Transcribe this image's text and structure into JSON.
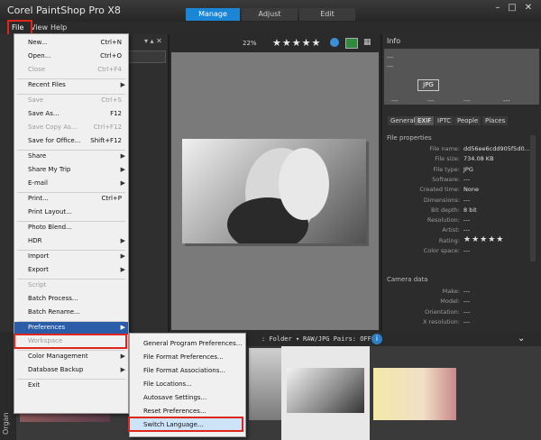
{
  "app": {
    "title": "Corel PaintShop Pro X8",
    "tabs": [
      "Manage",
      "Adjust",
      "Edit"
    ],
    "window_buttons": [
      "–",
      "□",
      "✕"
    ]
  },
  "menubar": [
    "File",
    "View",
    "Help"
  ],
  "toolbar": {
    "zoom": "22%",
    "rating_stars": "★★★★★"
  },
  "file_menu": {
    "items": [
      {
        "label": "New...",
        "shortcut": "Ctrl+N",
        "disabled": false
      },
      {
        "label": "Open...",
        "shortcut": "Ctrl+O",
        "disabled": false
      },
      {
        "label": "Close",
        "shortcut": "Ctrl+F4",
        "disabled": true
      },
      {
        "label": "Recent Files",
        "shortcut": "",
        "disabled": false,
        "submenu": true
      },
      {
        "label": "Save",
        "shortcut": "Ctrl+S",
        "disabled": true
      },
      {
        "label": "Save As...",
        "shortcut": "F12",
        "disabled": false
      },
      {
        "label": "Save Copy As...",
        "shortcut": "Ctrl+F12",
        "disabled": true
      },
      {
        "label": "Save for Office...",
        "shortcut": "Shift+F12",
        "disabled": false
      },
      {
        "label": "Share",
        "shortcut": "",
        "disabled": false,
        "submenu": true
      },
      {
        "label": "Share My Trip",
        "shortcut": "",
        "disabled": false,
        "submenu": true
      },
      {
        "label": "E-mail",
        "shortcut": "",
        "disabled": false,
        "submenu": true
      },
      {
        "label": "Print...",
        "shortcut": "Ctrl+P",
        "disabled": false
      },
      {
        "label": "Print Layout...",
        "shortcut": "",
        "disabled": false
      },
      {
        "label": "Photo Blend...",
        "shortcut": "",
        "disabled": false
      },
      {
        "label": "HDR",
        "shortcut": "",
        "disabled": false,
        "submenu": true
      },
      {
        "label": "Import",
        "shortcut": "",
        "disabled": false,
        "submenu": true
      },
      {
        "label": "Export",
        "shortcut": "",
        "disabled": false,
        "submenu": true
      },
      {
        "label": "Script",
        "shortcut": "",
        "disabled": true
      },
      {
        "label": "Batch Process...",
        "shortcut": "",
        "disabled": false
      },
      {
        "label": "Batch Rename...",
        "shortcut": "",
        "disabled": false
      },
      {
        "label": "Preferences",
        "shortcut": "",
        "disabled": false,
        "submenu": true
      },
      {
        "label": "Workspace",
        "shortcut": "",
        "disabled": true
      },
      {
        "label": "Color Management",
        "shortcut": "",
        "disabled": false,
        "submenu": true
      },
      {
        "label": "Database Backup",
        "shortcut": "",
        "disabled": false,
        "submenu": true
      },
      {
        "label": "Exit",
        "shortcut": "",
        "disabled": false
      }
    ]
  },
  "preferences_submenu": [
    "General Program Preferences...",
    "File Format Preferences...",
    "File Format Associations...",
    "File Locations...",
    "Autosave Settings...",
    "Reset Preferences...",
    "Switch Language..."
  ],
  "info_panel": {
    "title": "Info",
    "thumb_placeholders": [
      "---",
      "---"
    ],
    "jpg_badge": "JPG",
    "thumb_slots": [
      "---",
      "---",
      "---",
      "---"
    ],
    "tabs": [
      "General",
      "EXIF",
      "IPTC",
      "People",
      "Places"
    ],
    "file_properties_header": "File properties",
    "file_properties": [
      {
        "label": "File name:",
        "value": "dd56ee6cdd905f5d0..."
      },
      {
        "label": "File size:",
        "value": "734.08 KB"
      },
      {
        "label": "File type:",
        "value": "JPG"
      },
      {
        "label": "Software:",
        "value": "---"
      },
      {
        "label": "Created time:",
        "value": "None"
      },
      {
        "label": "Dimensions:",
        "value": "---"
      },
      {
        "label": "Bit depth:",
        "value": "8 bit"
      },
      {
        "label": "Resolution:",
        "value": "---"
      },
      {
        "label": "Artist:",
        "value": "---"
      },
      {
        "label": "Rating:",
        "value": "★★★★★"
      },
      {
        "label": "Color space:",
        "value": "---"
      }
    ],
    "camera_data_header": "Camera data",
    "camera_data": [
      {
        "label": "Make:",
        "value": "---"
      },
      {
        "label": "Model:",
        "value": "---"
      },
      {
        "label": "Orientation:",
        "value": "---"
      },
      {
        "label": "X resolution:",
        "value": "---"
      }
    ]
  },
  "filmstrip": {
    "folder_label": "Folder",
    "raw_pairs": "RAW/JPG Pairs: OFF",
    "organizer_label": "Organ"
  }
}
